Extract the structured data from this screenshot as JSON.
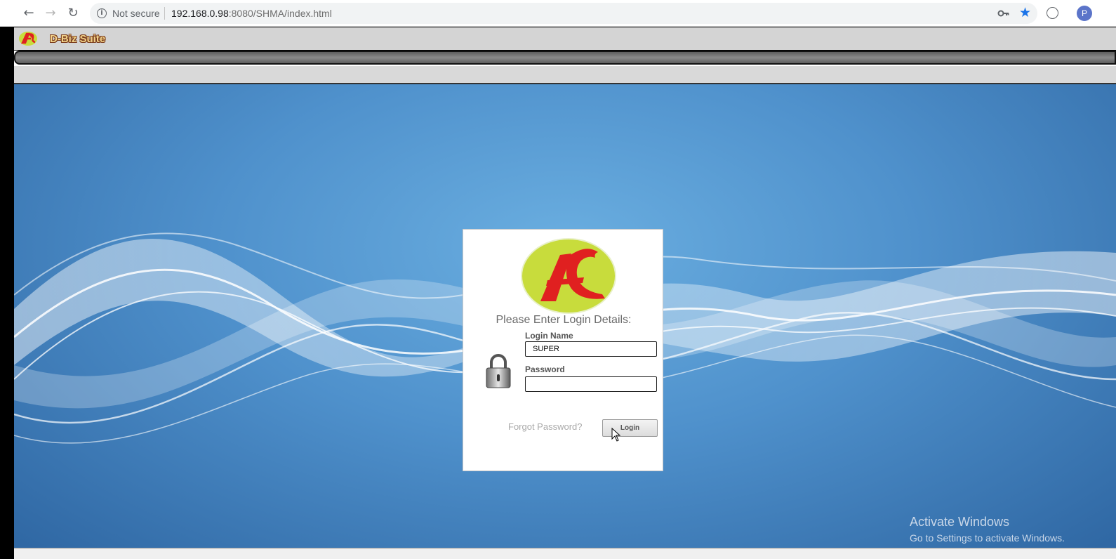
{
  "browser": {
    "security_label": "Not secure",
    "url_host": "192.168.0.98",
    "url_rest": ":8080/SHMA/index.html",
    "profile_initial": "P",
    "icons": [
      "back-icon",
      "forward-icon",
      "reload-icon",
      "info-icon",
      "key-icon",
      "star-icon",
      "extension-icon",
      "profile-icon"
    ]
  },
  "app": {
    "name": "D-Biz Suite"
  },
  "login": {
    "title": "Please Enter Login Details:",
    "login_name_label": "Login Name",
    "login_name_value": "SUPER",
    "password_label": "Password",
    "password_value": "",
    "forgot_password": "Forgot Password?",
    "login_button": "Login"
  },
  "watermark": {
    "title": "Activate Windows",
    "subtitle": "Go to Settings to activate Windows."
  },
  "colors": {
    "background_blue": "#4f91cc",
    "logo_green": "#c8dc3c",
    "logo_red": "#e02020",
    "star_blue": "#1a73e8"
  }
}
